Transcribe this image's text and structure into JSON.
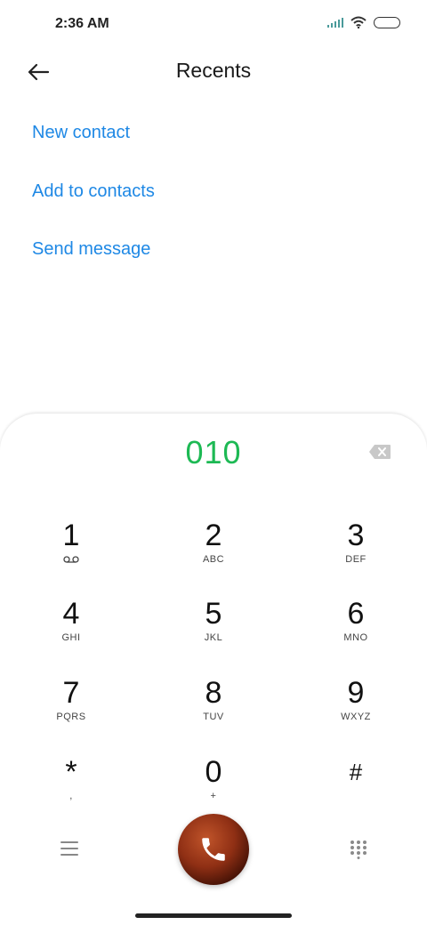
{
  "status_bar": {
    "time": "2:36 AM",
    "icons": [
      "signal-icon",
      "wifi-icon",
      "battery-icon"
    ]
  },
  "header": {
    "title": "Recents",
    "back_icon": "back-arrow-icon"
  },
  "actions": {
    "new_contact": "New contact",
    "add_to_contacts": "Add to contacts",
    "send_message": "Send message"
  },
  "dialer": {
    "number": "010",
    "backspace_icon": "backspace-icon",
    "keys": [
      {
        "digit": "1",
        "letters": ""
      },
      {
        "digit": "2",
        "letters": "ABC"
      },
      {
        "digit": "3",
        "letters": "DEF"
      },
      {
        "digit": "4",
        "letters": "GHI"
      },
      {
        "digit": "5",
        "letters": "JKL"
      },
      {
        "digit": "6",
        "letters": "MNO"
      },
      {
        "digit": "7",
        "letters": "PQRS"
      },
      {
        "digit": "8",
        "letters": "TUV"
      },
      {
        "digit": "9",
        "letters": "WXYZ"
      },
      {
        "digit": "*",
        "letters": ","
      },
      {
        "digit": "0",
        "letters": "+"
      },
      {
        "digit": "#",
        "letters": ""
      }
    ],
    "menu_icon": "menu-icon",
    "call_icon": "phone-icon",
    "dialpad_icon": "dialpad-icon"
  },
  "colors": {
    "accent": "#1e88e5",
    "number": "#1db954"
  }
}
